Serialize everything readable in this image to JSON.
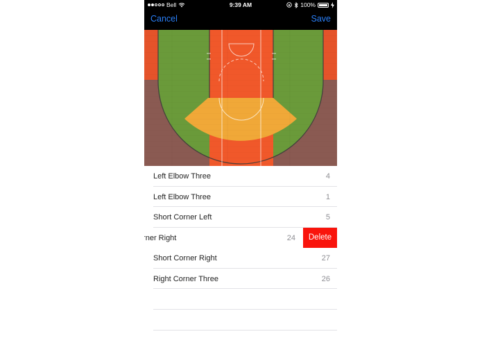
{
  "status_bar": {
    "carrier": "Bell",
    "time": "9:39 AM",
    "battery": "100%"
  },
  "nav": {
    "cancel_label": "Cancel",
    "save_label": "Save"
  },
  "shots": [
    {
      "label": "Left Elbow Three",
      "count": "4"
    },
    {
      "label": "Left Elbow Three",
      "count": "1"
    },
    {
      "label": "Short Corner Left",
      "count": "5"
    },
    {
      "label": "Short Corner Right",
      "count": "24",
      "visible_label": "Corner Right",
      "swiped": true
    },
    {
      "label": "Short Corner Right",
      "count": "27"
    },
    {
      "label": "Right Corner Three",
      "count": "26"
    }
  ],
  "delete_label": "Delete",
  "colors": {
    "accent": "#2a7ff7",
    "delete": "#f9140c",
    "zone_green": "#6a9a3a",
    "zone_orange": "#f0582a",
    "zone_yellow": "#f0a838",
    "zone_brown": "#8a5a52"
  }
}
